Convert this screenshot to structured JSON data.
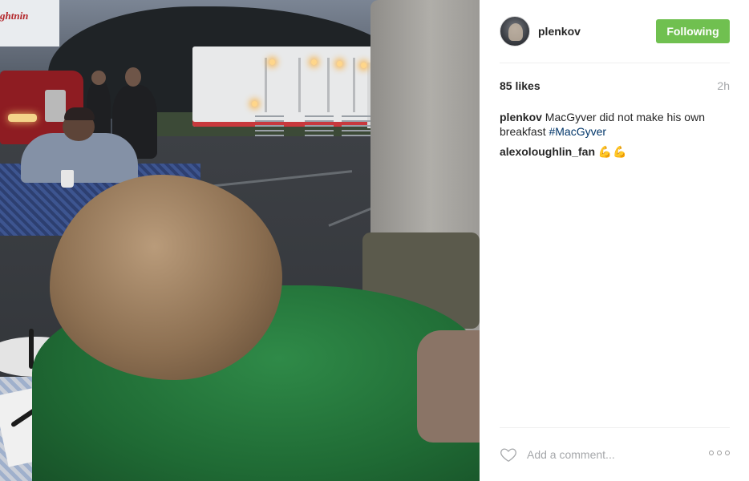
{
  "post": {
    "image_alt": "",
    "truck_logo": "ghtnin",
    "trailer_logo": ""
  },
  "header": {
    "username": "plenkov",
    "follow_button_label": "Following",
    "avatar_icon": "avatar-icon"
  },
  "stats": {
    "likes": "85 likes",
    "timestamp": "2h"
  },
  "comments": [
    {
      "user": "plenkov",
      "text": "MacGyver did not make his own breakfast",
      "hashtag": "#MacGyver"
    },
    {
      "user": "alexoloughlin_fan",
      "text": "💪💪"
    }
  ],
  "footer": {
    "comment_placeholder": "Add a comment...",
    "like_icon": "heart-icon",
    "more_icon": "more-options-icon"
  },
  "colors": {
    "follow_button": "#70c050",
    "hashtag": "#003569",
    "muted": "#a5a7aa"
  }
}
